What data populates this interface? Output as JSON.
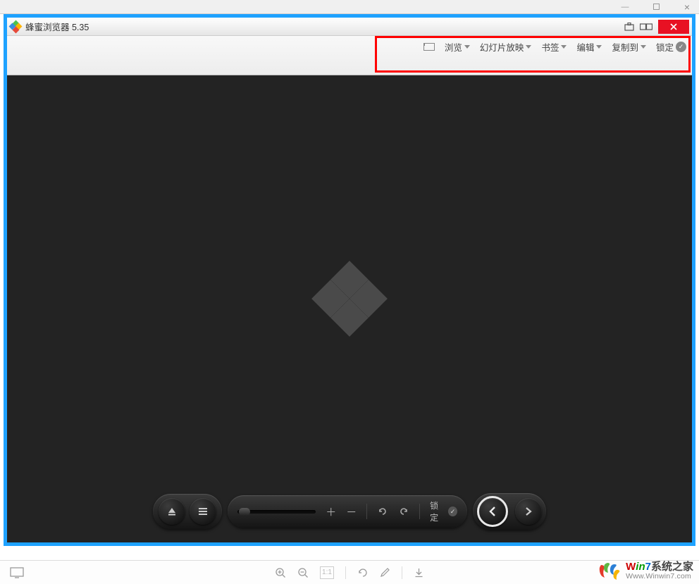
{
  "os": {
    "min": "—",
    "close": "×"
  },
  "app": {
    "title": "蜂蜜浏览器 5.35"
  },
  "toolbar": {
    "browse": "浏览",
    "slideshow": "幻灯片放映",
    "bookmark": "书签",
    "edit": "编辑",
    "copyto": "复制到",
    "lock": "锁定"
  },
  "floatbar": {
    "lock_label": "锁定",
    "page_num": "1:1"
  },
  "watermark": {
    "brand_w": "W",
    "brand_in": "in",
    "brand_7": "7",
    "brand_cn": "系统之家",
    "url": "Www.Winwin7.com"
  }
}
